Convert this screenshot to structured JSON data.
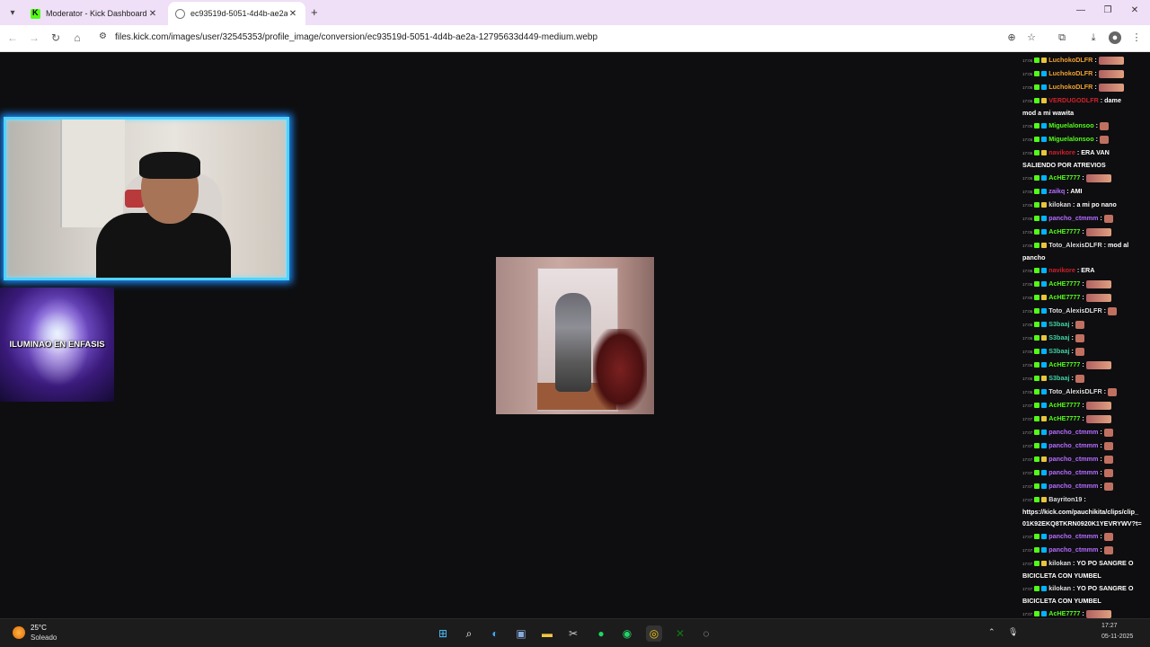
{
  "browser": {
    "tabs": [
      {
        "title": "Moderator - Kick Dashboard",
        "active": false
      },
      {
        "title": "ec93519d-5051-4d4b-ae2a-12795633d449-medium.webp",
        "active": true
      }
    ],
    "url": "files.kick.com/images/user/32545353/profile_image/conversion/ec93519d-5051-4d4b-ae2a-12795633d449-medium.webp"
  },
  "overlay": {
    "badge_text": "ILUMINAO EN ENFASIS"
  },
  "chat": [
    {
      "time": "17:06",
      "user": "LuchokoDLFR",
      "color": "#f0a030",
      "text": "",
      "emote": "big"
    },
    {
      "time": "17:06",
      "user": "LuchokoDLFR",
      "color": "#f0a030",
      "text": "",
      "emote": "big"
    },
    {
      "time": "17:06",
      "user": "LuchokoDLFR",
      "color": "#f0a030",
      "text": "",
      "emote": "big"
    },
    {
      "time": "17:06",
      "user": "VERDUGODLFR",
      "color": "#d0202a",
      "text": "dame",
      "cont": "mod a mi wawita"
    },
    {
      "time": "17:06",
      "user": "Miguelalonsoo",
      "color": "#53fc18",
      "text": "",
      "emote": "small"
    },
    {
      "time": "17:06",
      "user": "Miguelalonsoo",
      "color": "#53fc18",
      "text": "",
      "emote": "small"
    },
    {
      "time": "17:06",
      "user": "navikore",
      "color": "#d0202a",
      "text": "ERA VAN",
      "cont": "SALIENDO POR ATREVIOS"
    },
    {
      "time": "17:06",
      "user": "AcHE7777",
      "color": "#53fc18",
      "text": "",
      "emote": "big"
    },
    {
      "time": "17:06",
      "user": "zaikq",
      "color": "#b36bff",
      "text": "AMI"
    },
    {
      "time": "17:06",
      "user": "kilokan",
      "color": "#dddddd",
      "text": "a mi po nano"
    },
    {
      "time": "17:06",
      "user": "pancho_ctmmm",
      "color": "#b36bff",
      "text": "",
      "emote": "small"
    },
    {
      "time": "17:06",
      "user": "AcHE7777",
      "color": "#53fc18",
      "text": "",
      "emote": "big"
    },
    {
      "time": "17:06",
      "user": "Toto_AlexisDLFR",
      "color": "#dddddd",
      "text": "mod al",
      "cont": "pancho"
    },
    {
      "time": "17:06",
      "user": "navikore",
      "color": "#d0202a",
      "text": "ERA"
    },
    {
      "time": "17:06",
      "user": "AcHE7777",
      "color": "#53fc18",
      "text": "",
      "emote": "big"
    },
    {
      "time": "17:06",
      "user": "AcHE7777",
      "color": "#53fc18",
      "text": "",
      "emote": "big"
    },
    {
      "time": "17:06",
      "user": "Toto_AlexisDLFR",
      "color": "#dddddd",
      "text": "",
      "emote": "small"
    },
    {
      "time": "17:06",
      "user": "S3baaj",
      "color": "#3fd0a0",
      "text": "",
      "emote": "small"
    },
    {
      "time": "17:06",
      "user": "S3baaj",
      "color": "#3fd0a0",
      "text": "",
      "emote": "small"
    },
    {
      "time": "17:06",
      "user": "S3baaj",
      "color": "#3fd0a0",
      "text": "",
      "emote": "small"
    },
    {
      "time": "17:06",
      "user": "AcHE7777",
      "color": "#53fc18",
      "text": "",
      "emote": "big"
    },
    {
      "time": "17:06",
      "user": "S3baaj",
      "color": "#3fd0a0",
      "text": "",
      "emote": "small"
    },
    {
      "time": "17:06",
      "user": "Toto_AlexisDLFR",
      "color": "#dddddd",
      "text": "",
      "emote": "small"
    },
    {
      "time": "17:07",
      "user": "AcHE7777",
      "color": "#53fc18",
      "text": "",
      "emote": "big"
    },
    {
      "time": "17:07",
      "user": "AcHE7777",
      "color": "#53fc18",
      "text": "",
      "emote": "big"
    },
    {
      "time": "17:07",
      "user": "pancho_ctmmm",
      "color": "#b36bff",
      "text": "",
      "emote": "small"
    },
    {
      "time": "17:07",
      "user": "pancho_ctmmm",
      "color": "#b36bff",
      "text": "",
      "emote": "small"
    },
    {
      "time": "17:07",
      "user": "pancho_ctmmm",
      "color": "#b36bff",
      "text": "",
      "emote": "small"
    },
    {
      "time": "17:07",
      "user": "pancho_ctmmm",
      "color": "#b36bff",
      "text": "",
      "emote": "small"
    },
    {
      "time": "17:07",
      "user": "pancho_ctmmm",
      "color": "#b36bff",
      "text": "",
      "emote": "small"
    },
    {
      "time": "17:07",
      "user": "Bayriton19",
      "color": "#dddddd",
      "text": "",
      "cont": "https://kick.com/pauchikita/clips/clip_",
      "cont2": "01K92EKQ8TKRN0920K1YEVRYWV?t="
    },
    {
      "time": "17:07",
      "user": "pancho_ctmmm",
      "color": "#b36bff",
      "text": "",
      "emote": "small"
    },
    {
      "time": "17:07",
      "user": "pancho_ctmmm",
      "color": "#b36bff",
      "text": "",
      "emote": "small"
    },
    {
      "time": "17:07",
      "user": "kilokan",
      "color": "#dddddd",
      "text": "YO PO SANGRE O",
      "cont": "BICICLETA CON YUMBEL"
    },
    {
      "time": "17:07",
      "user": "kilokan",
      "color": "#dddddd",
      "text": "YO PO SANGRE O",
      "cont": "BICICLETA CON YUMBEL"
    },
    {
      "time": "17:07",
      "user": "AcHE7777",
      "color": "#53fc18",
      "text": "",
      "emote": "big"
    },
    {
      "time": "17:07",
      "user": "AcHE7777",
      "color": "#53fc18",
      "text": "",
      "emote": "big"
    }
  ],
  "taskbar": {
    "temp": "25°C",
    "condition": "Soleado",
    "time": "17:27",
    "date": "05-11-2025"
  }
}
